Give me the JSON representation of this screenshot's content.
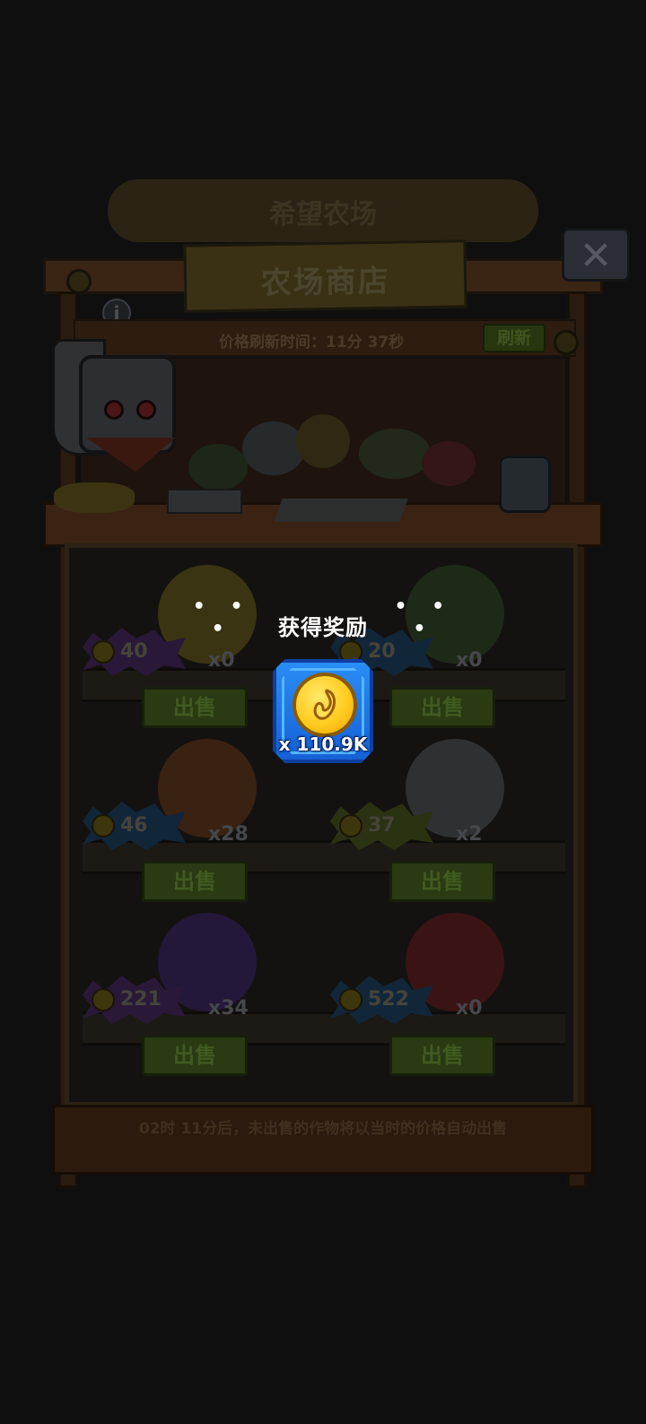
{
  "banner_back_label": "希望农场",
  "shop": {
    "title": "农场商店",
    "refresh_timer": "价格刷新时间：11分 37秒",
    "refresh_label": "刷新",
    "close_glyph": "✕",
    "info_glyph": "i"
  },
  "items": [
    {
      "price": "40",
      "qty": "x0",
      "sell_label": "出售",
      "veg": "mango-icon",
      "veg_color": "#3a3412",
      "burst_color": "#2a1838"
    },
    {
      "price": "20",
      "qty": "x0",
      "sell_label": "出售",
      "veg": "cabbage-icon",
      "veg_color": "#1d2a18",
      "burst_color": "#12263a"
    },
    {
      "price": "46",
      "qty": "x28",
      "sell_label": "出售",
      "veg": "carrot-icon",
      "veg_color": "#3a2212",
      "burst_color": "#12263a"
    },
    {
      "price": "37",
      "qty": "x2",
      "sell_label": "出售",
      "veg": "radish-icon",
      "veg_color": "#2e3032",
      "burst_color": "#2a3212"
    },
    {
      "price": "221",
      "qty": "x34",
      "sell_label": "出售",
      "veg": "eggplant-icon",
      "veg_color": "#24183a",
      "burst_color": "#2a1838"
    },
    {
      "price": "522",
      "qty": "x0",
      "sell_label": "出售",
      "veg": "strawberry-icon",
      "veg_color": "#3a1414",
      "burst_color": "#12263a"
    }
  ],
  "footer_note": "02时 11分后，未出售的作物将以当时的价格自动出售",
  "reward": {
    "title": "获得奖励",
    "dots_left": "• • •",
    "dots_right": "• • •",
    "amount": "x 110.9K",
    "icon": "gold-coin-icon"
  },
  "colors": {
    "reward_card": "#1f78ee",
    "coin": "#ffcc1f"
  }
}
